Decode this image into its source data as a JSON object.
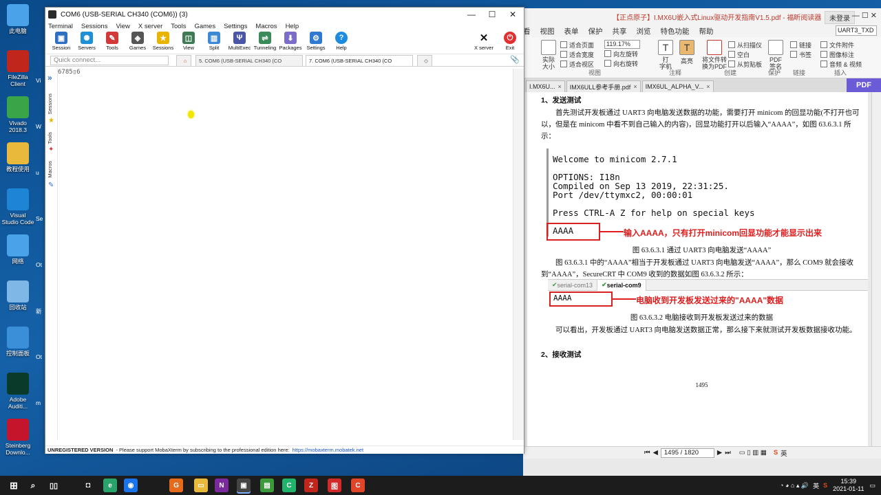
{
  "desktop": {
    "icons": [
      {
        "label": "此电脑",
        "color": "#4aa3e8"
      },
      {
        "label": "FileZilla Client",
        "color": "#c0261c"
      },
      {
        "label": "Vivado 2018.3",
        "color": "#3aa548"
      },
      {
        "label": "教程使用",
        "color": "#e8b93a"
      },
      {
        "label": "Visual Studio Code",
        "color": "#1d84d6"
      },
      {
        "label": "网络",
        "color": "#4aa3e8"
      },
      {
        "label": "回收站",
        "color": "#7fb8e6"
      },
      {
        "label": "控制面板",
        "color": "#3a8fd8"
      },
      {
        "label": "Adobe Auditi...",
        "color": "#0a3a2a"
      },
      {
        "label": "Steinberg Downlo...",
        "color": "#c4152c"
      }
    ],
    "second_column": [
      "Vi",
      "W",
      "u",
      "Se",
      "Ot",
      "新",
      "Ot",
      "m"
    ]
  },
  "moba": {
    "title": "COM6  (USB-SERIAL CH340 (COM6)) (3)",
    "menu": [
      "Terminal",
      "Sessions",
      "View",
      "X server",
      "Tools",
      "Games",
      "Settings",
      "Macros",
      "Help"
    ],
    "toolbar": [
      {
        "label": "Session",
        "icon": "session-icon",
        "color": "#2f6fc2"
      },
      {
        "label": "Servers",
        "icon": "servers-icon",
        "color": "#1f8fd6"
      },
      {
        "label": "Tools",
        "icon": "tools-icon",
        "color": "#d23a3a"
      },
      {
        "label": "Games",
        "icon": "games-icon",
        "color": "#555555"
      },
      {
        "label": "Sessions",
        "icon": "star-icon",
        "color": "#e8b400"
      },
      {
        "label": "View",
        "icon": "view-icon",
        "color": "#3f7a55"
      },
      {
        "label": "Split",
        "icon": "split-icon",
        "color": "#3c8ad6"
      },
      {
        "label": "MultiExec",
        "icon": "multiexec-icon",
        "color": "#4a55a8"
      },
      {
        "label": "Tunneling",
        "icon": "tunneling-icon",
        "color": "#3b8a5a"
      },
      {
        "label": "Packages",
        "icon": "packages-icon",
        "color": "#7c6cc9"
      },
      {
        "label": "Settings",
        "icon": "settings-icon",
        "color": "#2f7ad0"
      },
      {
        "label": "Help",
        "icon": "help-icon",
        "color": "#1d8ce0"
      }
    ],
    "xserver": {
      "label": "X server"
    },
    "exit": {
      "label": "Exit"
    },
    "quick_connect_placeholder": "Quick connect...",
    "tabs": [
      {
        "label": "5. COM6  (USB-SERIAL CH340 (CO",
        "active": false
      },
      {
        "label": "7. COM6  (USB-SERIAL CH340 (CO",
        "active": true
      }
    ],
    "sidebar": [
      "Sessions",
      "Tools",
      "Macros"
    ],
    "terminal_lines": [
      "6785▯6"
    ],
    "status": {
      "unregistered": "UNREGISTERED VERSION",
      "message": "-  Please support MobaXterm by subscribing to the professional edition here:",
      "link": "https://mobaxterm.mobatek.net"
    }
  },
  "pdf": {
    "title": "【正点原子】I.MX6U嵌入式Linux驱动开发指南V1.5.pdf - 福昕阅读器",
    "login": "未登录",
    "menu": [
      "看",
      "视图",
      "表单",
      "保护",
      "共享",
      "浏览",
      "特色功能",
      "帮助"
    ],
    "search_value": "UART3_TXD",
    "ribbon": {
      "actual_size": "实际\n大小",
      "fit_items": [
        "适合页面",
        "适合宽度",
        "适合视区"
      ],
      "zoom": "119.17%",
      "rotate_items": [
        "向左旋转",
        "向右旋转"
      ],
      "group_view": "视图",
      "typewriter": "打\n字机",
      "highlight": "高亮",
      "group_comment": "注释",
      "convert": "将文件转\n换为PDF",
      "create_items": [
        "从扫描仪",
        "空白",
        "从剪贴板"
      ],
      "group_create": "创建",
      "pdf_sign": "PDF\n签名",
      "group_protect": "保护",
      "link_items": [
        "链接",
        "书签"
      ],
      "group_link": "链接",
      "insert_items": [
        "文件附件",
        "图像标注",
        "音频 & 视频"
      ],
      "group_insert": "插入"
    },
    "tabs": [
      "I.MX6U...",
      "IMX6ULL参考手册.pdf",
      "IMX6UL_ALPHA_V..."
    ],
    "pdf_tab_label": "PDF",
    "page": {
      "heading1": "1、发送测试",
      "para1": "首先测试开发板通过 UART3 向电脑发送数据的功能，需要打开 minicom 的回显功能(不打开也可以，但是在 minicom 中看不到自己输入的内容)，回显功能打开以后输入“AAAA”，如图 63.6.3.1 所示：",
      "terminal": [
        "Welcome to minicom 2.7.1",
        "OPTIONS: I18n",
        "Compiled on Sep 13 2019, 22:31:25.",
        "Port /dev/ttymxc2, 00:00:01",
        "Press CTRL-A Z for help on special keys",
        "AAAA"
      ],
      "annotation1": "输入AAAA，只有打开minicom回显功能才能显示出来",
      "caption1": "图 63.6.3.1  通过 UART3 向电脑发送“AAAA”",
      "para2": "图 63.6.3.1 中的“AAAA”相当于开发板通过 UART3 向电脑发送“AAAA”，那么 COM9 就会接收到“AAAA”，SecureCRT 中 COM9 收到的数据如图 63.6.3.2 所示：",
      "crt_tabs": [
        "serial-com13",
        "serial-com9"
      ],
      "crt_text": "AAAA",
      "annotation2": "电脑收到开发板发送过来的\"AAAA\"数据",
      "caption2": "图 63.6.3.2  电脑接收到开发板发送过来的数据",
      "para3": "可以看出，开发板通过 UART3 向电脑发送数据正常，那么接下来就测试开发板数据接收功能。",
      "heading2": "2、接收测试",
      "page_number": "1495"
    },
    "status": {
      "page_box": "1495 / 1820"
    }
  },
  "taskbar": {
    "apps": [
      {
        "icon": "edge-icon",
        "color": "#2aa36b",
        "glyph": "e"
      },
      {
        "icon": "chrome-icon",
        "color": "#1a73e8",
        "glyph": "◉"
      },
      {
        "icon": "foxit-icon",
        "color": "#e66a1c",
        "glyph": "G"
      },
      {
        "icon": "explorer-icon",
        "color": "#e8b93a",
        "glyph": "▭"
      },
      {
        "icon": "onenote-icon",
        "color": "#7b2a9e",
        "glyph": "N"
      },
      {
        "icon": "mobaxterm-icon",
        "color": "#444444",
        "glyph": "▣"
      },
      {
        "icon": "notepad-icon",
        "color": "#3c9a3c",
        "glyph": "▤"
      },
      {
        "icon": "clion-icon",
        "color": "#21b36b",
        "glyph": "C"
      },
      {
        "icon": "filezilla-icon",
        "color": "#c0261c",
        "glyph": "Z"
      },
      {
        "icon": "app-red-icon",
        "color": "#d22a2a",
        "glyph": "图"
      },
      {
        "icon": "capture-icon",
        "color": "#e0452a",
        "glyph": "C"
      }
    ],
    "clock_time": "15:39",
    "clock_date": "2021-01-11",
    "ime": "英"
  }
}
